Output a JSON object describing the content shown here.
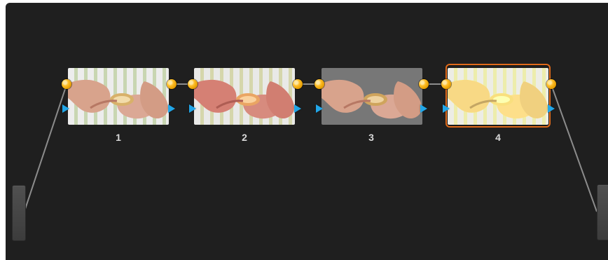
{
  "nodes": [
    {
      "label": "1",
      "selected": false
    },
    {
      "label": "2",
      "selected": false
    },
    {
      "label": "3",
      "selected": false
    },
    {
      "label": "4",
      "selected": true
    }
  ],
  "colors": {
    "background": "#1f1f1f",
    "connection_line": "#8c8c8c",
    "output_port": "#f5b500",
    "input_triangle": "#21a6e8",
    "selection_border": "#e06a1a",
    "node_label": "#d9d9d9"
  },
  "icons": {
    "rgb_port": "yellow-circle-port-icon",
    "key_input": "blue-triangle-icon"
  }
}
